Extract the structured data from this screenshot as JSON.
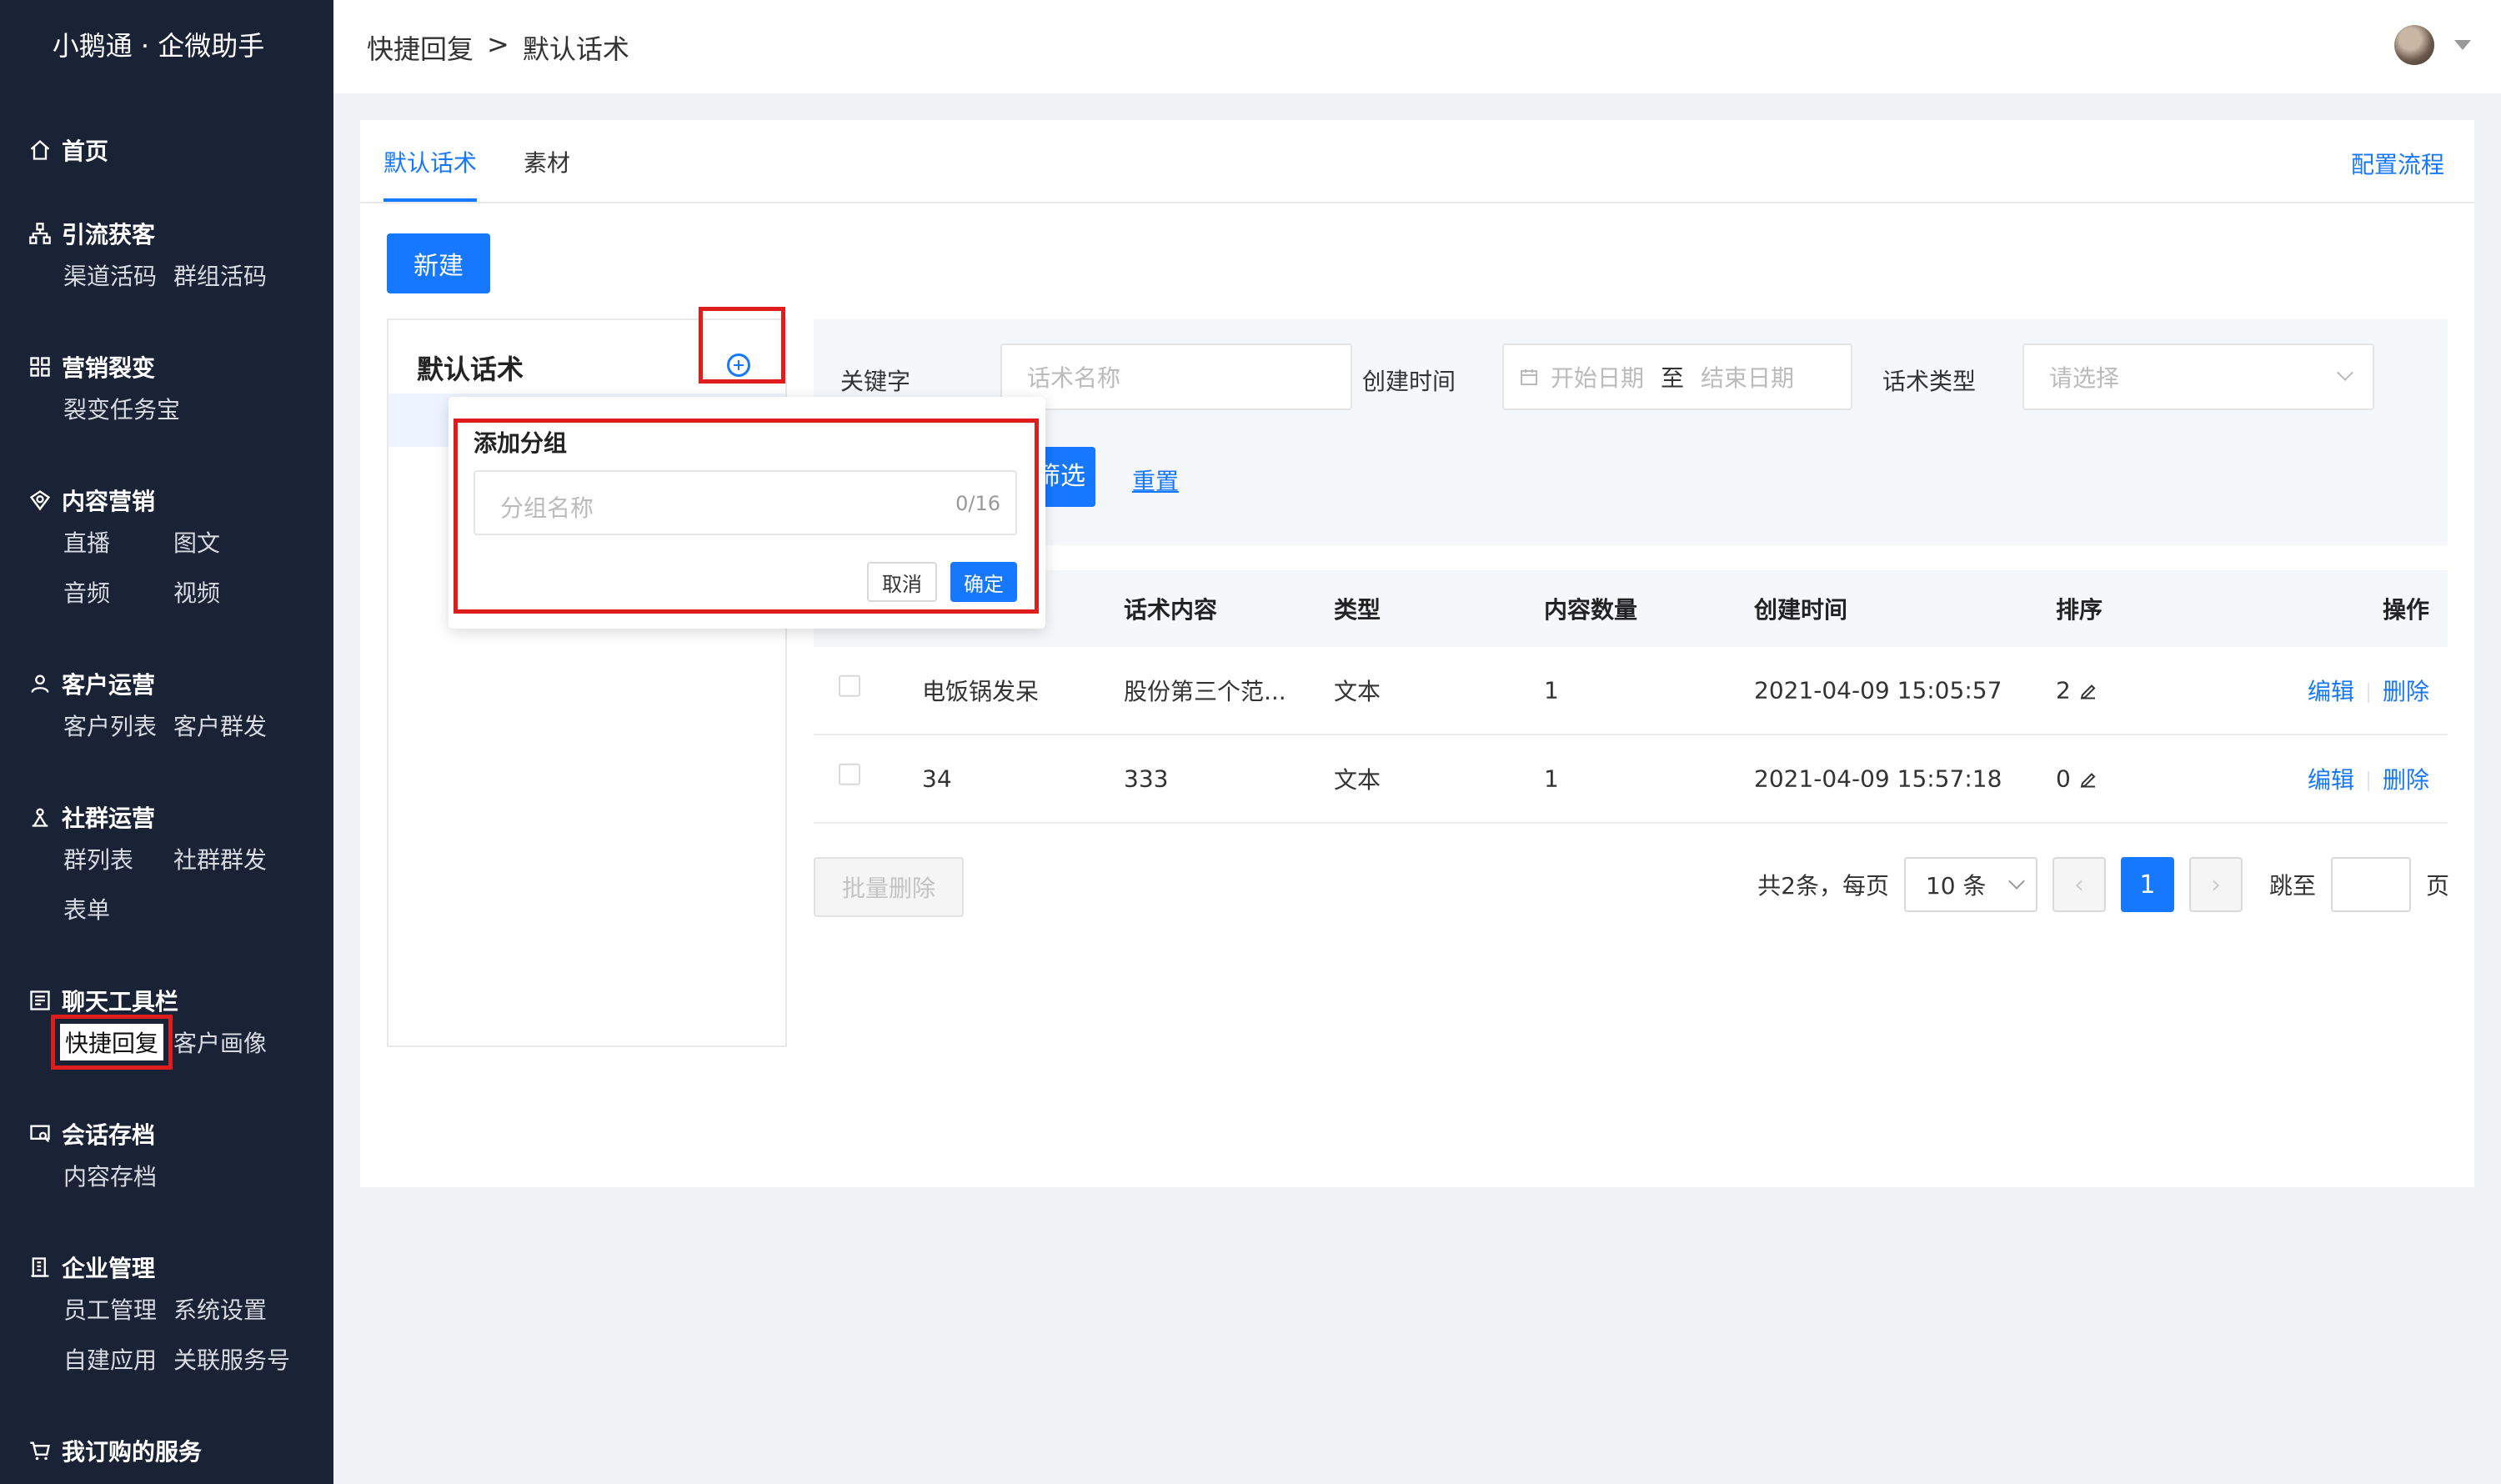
{
  "app": {
    "title": "小鹅通 · 企微助手"
  },
  "breadcrumb": {
    "parent": "快捷回复",
    "sep": ">",
    "current": "默认话术"
  },
  "sidebar": {
    "home": "首页",
    "groups": [
      {
        "title": "引流获客",
        "items": [
          "渠道活码",
          "群组活码"
        ]
      },
      {
        "title": "营销裂变",
        "items": [
          "裂变任务宝"
        ]
      },
      {
        "title": "内容营销",
        "items": [
          "直播",
          "图文",
          "音频",
          "视频"
        ]
      },
      {
        "title": "客户运营",
        "items": [
          "客户列表",
          "客户群发"
        ]
      },
      {
        "title": "社群运营",
        "items": [
          "群列表",
          "社群群发",
          "表单"
        ]
      },
      {
        "title": "聊天工具栏",
        "items": [
          "快捷回复",
          "客户画像"
        ]
      },
      {
        "title": "会话存档",
        "items": [
          "内容存档"
        ]
      },
      {
        "title": "企业管理",
        "items": [
          "员工管理",
          "系统设置",
          "自建应用",
          "关联服务号"
        ]
      },
      {
        "title": "我订购的服务",
        "items": []
      }
    ]
  },
  "tabs": [
    "默认话术",
    "素材"
  ],
  "config_link": "配置流程",
  "new_button": "新建",
  "group_panel": {
    "title": "默认话术"
  },
  "filter": {
    "keyword_label": "关键字",
    "keyword_placeholder": "话术名称",
    "time_label": "创建时间",
    "start_placeholder": "开始日期",
    "to": "至",
    "end_placeholder": "结束日期",
    "type_label": "话术类型",
    "type_placeholder": "请选择",
    "filter_button": "筛选",
    "filter_button_visible": "筛选",
    "reset": "重置"
  },
  "table": {
    "headers": [
      "话术内容",
      "类型",
      "内容数量",
      "创建时间",
      "排序",
      "操作"
    ],
    "rows": [
      {
        "name": "电饭锅发呆",
        "content": "股份第三个范...",
        "type": "文本",
        "count": "1",
        "time": "2021-04-09 15:05:57",
        "order": "2"
      },
      {
        "name": "34",
        "content": "333",
        "type": "文本",
        "count": "1",
        "time": "2021-04-09 15:57:18",
        "order": "0"
      }
    ],
    "edit": "编辑",
    "delete": "删除"
  },
  "footer": {
    "batch_delete": "批量删除",
    "total": "共2条，每页",
    "page_size": "10 条",
    "current_page": "1",
    "jump_label": "跳至",
    "page_unit": "页"
  },
  "popover": {
    "title": "添加分组",
    "placeholder": "分组名称",
    "count": "0/16",
    "cancel": "取消",
    "ok": "确定"
  },
  "colors": {
    "primary": "#1677ff",
    "sidebar_bg": "#1a2336",
    "highlight": "#e01d1d"
  }
}
